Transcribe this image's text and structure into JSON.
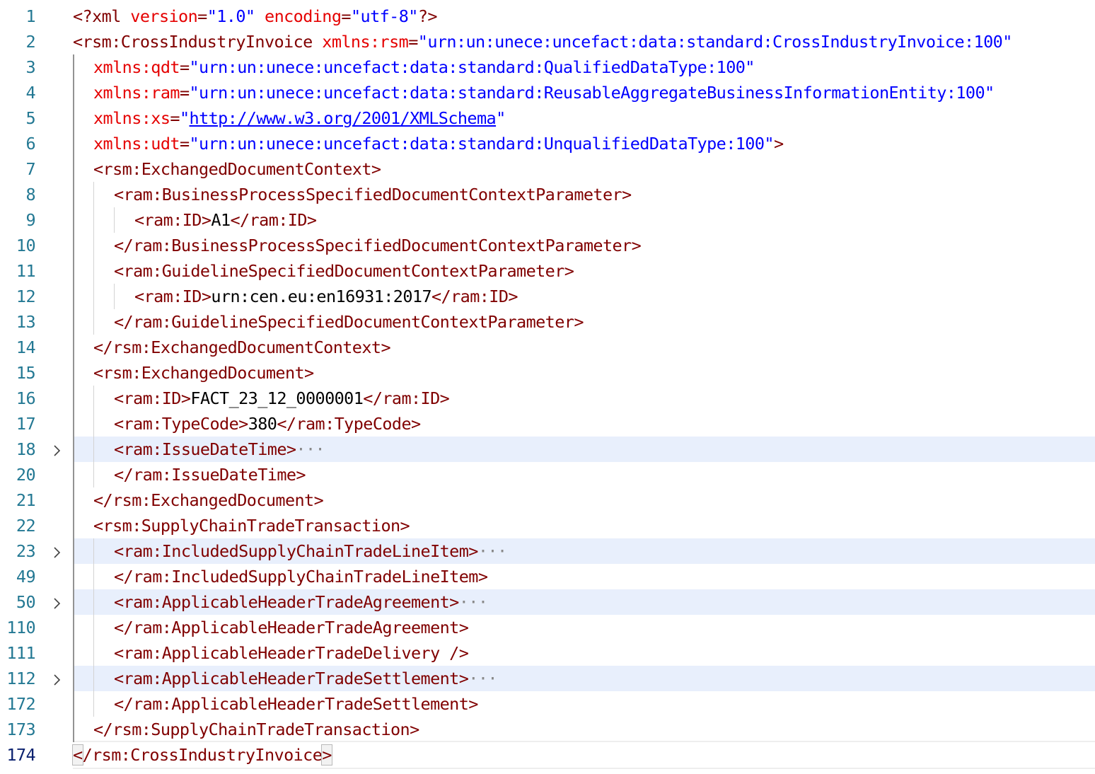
{
  "editor": {
    "lines": [
      {
        "n": "1",
        "indent": 0,
        "kind": "decl",
        "tokens": [
          {
            "c": "tg",
            "t": "<?xml "
          },
          {
            "c": "an",
            "t": "version"
          },
          {
            "c": "tg",
            "t": "="
          },
          {
            "c": "av",
            "t": "\"1.0\""
          },
          {
            "c": "",
            "t": " "
          },
          {
            "c": "an",
            "t": "encoding"
          },
          {
            "c": "tg",
            "t": "="
          },
          {
            "c": "av",
            "t": "\"utf-8\""
          },
          {
            "c": "tg",
            "t": "?>"
          }
        ]
      },
      {
        "n": "2",
        "indent": 0,
        "tokens": [
          {
            "c": "tg",
            "t": "<rsm:CrossIndustryInvoice "
          },
          {
            "c": "an",
            "t": "xmlns:rsm"
          },
          {
            "c": "tg",
            "t": "="
          },
          {
            "c": "av",
            "t": "\"urn:un:unece:uncefact:data:standard:CrossIndustryInvoice:100\""
          }
        ]
      },
      {
        "n": "3",
        "indent": 1,
        "tokens": [
          {
            "c": "an",
            "t": "xmlns:qdt"
          },
          {
            "c": "tg",
            "t": "="
          },
          {
            "c": "av",
            "t": "\"urn:un:unece:uncefact:data:standard:QualifiedDataType:100\""
          }
        ]
      },
      {
        "n": "4",
        "indent": 1,
        "tokens": [
          {
            "c": "an",
            "t": "xmlns:ram"
          },
          {
            "c": "tg",
            "t": "="
          },
          {
            "c": "av",
            "t": "\"urn:un:unece:uncefact:data:standard:ReusableAggregateBusinessInformationEntity:100\""
          }
        ]
      },
      {
        "n": "5",
        "indent": 1,
        "tokens": [
          {
            "c": "an",
            "t": "xmlns:xs"
          },
          {
            "c": "tg",
            "t": "="
          },
          {
            "c": "av",
            "t": "\""
          },
          {
            "c": "lk",
            "t": "http://www.w3.org/2001/XMLSchema"
          },
          {
            "c": "av",
            "t": "\""
          }
        ]
      },
      {
        "n": "6",
        "indent": 1,
        "tokens": [
          {
            "c": "an",
            "t": "xmlns:udt"
          },
          {
            "c": "tg",
            "t": "="
          },
          {
            "c": "av",
            "t": "\"urn:un:unece:uncefact:data:standard:UnqualifiedDataType:100\""
          },
          {
            "c": "tg",
            "t": ">"
          }
        ]
      },
      {
        "n": "7",
        "indent": 1,
        "tokens": [
          {
            "c": "tg",
            "t": "<rsm:ExchangedDocumentContext>"
          }
        ]
      },
      {
        "n": "8",
        "indent": 2,
        "tokens": [
          {
            "c": "tg",
            "t": "<ram:BusinessProcessSpecifiedDocumentContextParameter>"
          }
        ]
      },
      {
        "n": "9",
        "indent": 3,
        "tokens": [
          {
            "c": "tg",
            "t": "<ram:ID>"
          },
          {
            "c": "",
            "t": "A1"
          },
          {
            "c": "tg",
            "t": "</ram:ID>"
          }
        ]
      },
      {
        "n": "10",
        "indent": 2,
        "tokens": [
          {
            "c": "tg",
            "t": "</ram:BusinessProcessSpecifiedDocumentContextParameter>"
          }
        ]
      },
      {
        "n": "11",
        "indent": 2,
        "tokens": [
          {
            "c": "tg",
            "t": "<ram:GuidelineSpecifiedDocumentContextParameter>"
          }
        ]
      },
      {
        "n": "12",
        "indent": 3,
        "tokens": [
          {
            "c": "tg",
            "t": "<ram:ID>"
          },
          {
            "c": "",
            "t": "urn:cen.eu:en16931:2017"
          },
          {
            "c": "tg",
            "t": "</ram:ID>"
          }
        ]
      },
      {
        "n": "13",
        "indent": 2,
        "tokens": [
          {
            "c": "tg",
            "t": "</ram:GuidelineSpecifiedDocumentContextParameter>"
          }
        ]
      },
      {
        "n": "14",
        "indent": 1,
        "tokens": [
          {
            "c": "tg",
            "t": "</rsm:ExchangedDocumentContext>"
          }
        ]
      },
      {
        "n": "15",
        "indent": 1,
        "tokens": [
          {
            "c": "tg",
            "t": "<rsm:ExchangedDocument>"
          }
        ]
      },
      {
        "n": "16",
        "indent": 2,
        "tokens": [
          {
            "c": "tg",
            "t": "<ram:ID>"
          },
          {
            "c": "",
            "t": "FACT_23_12_0000001"
          },
          {
            "c": "tg",
            "t": "</ram:ID>"
          }
        ]
      },
      {
        "n": "17",
        "indent": 2,
        "tokens": [
          {
            "c": "tg",
            "t": "<ram:TypeCode>"
          },
          {
            "c": "",
            "t": "380"
          },
          {
            "c": "tg",
            "t": "</ram:TypeCode>"
          }
        ]
      },
      {
        "n": "18",
        "indent": 2,
        "folded": true,
        "tokens": [
          {
            "c": "tg",
            "t": "<ram:IssueDateTime>"
          },
          {
            "c": "ell",
            "t": "···"
          }
        ]
      },
      {
        "n": "20",
        "indent": 2,
        "tokens": [
          {
            "c": "tg",
            "t": "</ram:IssueDateTime>"
          }
        ]
      },
      {
        "n": "21",
        "indent": 1,
        "tokens": [
          {
            "c": "tg",
            "t": "</rsm:ExchangedDocument>"
          }
        ]
      },
      {
        "n": "22",
        "indent": 1,
        "tokens": [
          {
            "c": "tg",
            "t": "<rsm:SupplyChainTradeTransaction>"
          }
        ]
      },
      {
        "n": "23",
        "indent": 2,
        "folded": true,
        "tokens": [
          {
            "c": "tg",
            "t": "<ram:IncludedSupplyChainTradeLineItem>"
          },
          {
            "c": "ell",
            "t": "···"
          }
        ]
      },
      {
        "n": "49",
        "indent": 2,
        "tokens": [
          {
            "c": "tg",
            "t": "</ram:IncludedSupplyChainTradeLineItem>"
          }
        ]
      },
      {
        "n": "50",
        "indent": 2,
        "folded": true,
        "tokens": [
          {
            "c": "tg",
            "t": "<ram:ApplicableHeaderTradeAgreement>"
          },
          {
            "c": "ell",
            "t": "···"
          }
        ]
      },
      {
        "n": "110",
        "indent": 2,
        "tokens": [
          {
            "c": "tg",
            "t": "</ram:ApplicableHeaderTradeAgreement>"
          }
        ]
      },
      {
        "n": "111",
        "indent": 2,
        "tokens": [
          {
            "c": "tg",
            "t": "<ram:ApplicableHeaderTradeDelivery />"
          }
        ]
      },
      {
        "n": "112",
        "indent": 2,
        "folded": true,
        "tokens": [
          {
            "c": "tg",
            "t": "<ram:ApplicableHeaderTradeSettlement>"
          },
          {
            "c": "ell",
            "t": "···"
          }
        ]
      },
      {
        "n": "172",
        "indent": 2,
        "tokens": [
          {
            "c": "tg",
            "t": "</ram:ApplicableHeaderTradeSettlement>"
          }
        ]
      },
      {
        "n": "173",
        "indent": 1,
        "tokens": [
          {
            "c": "tg",
            "t": "</rsm:SupplyChainTradeTransaction>"
          }
        ]
      },
      {
        "n": "174",
        "indent": 0,
        "current": true,
        "tokens": [
          {
            "c": "tg bracket",
            "t": "<"
          },
          {
            "c": "tg",
            "t": "/rsm:CrossIndustryInvoice"
          },
          {
            "c": "tg bracket",
            "t": ">"
          }
        ]
      }
    ],
    "colors": {
      "tag": "#800000",
      "attribute_name": "#e50000",
      "attribute_value": "#0000ff",
      "line_number": "#237893",
      "fold_highlight": "#e8effc"
    }
  }
}
